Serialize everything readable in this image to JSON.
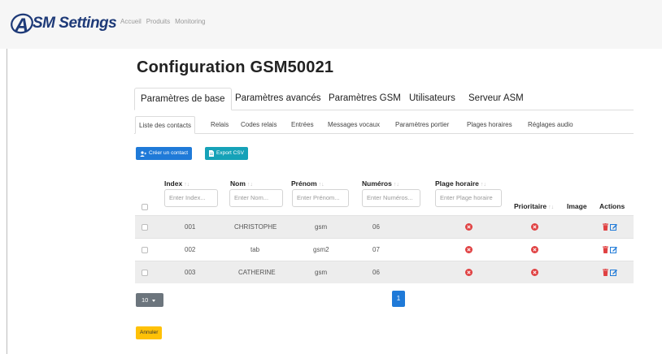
{
  "navbar": {
    "brand": "SM Settings",
    "links": [
      "Accueil",
      "Produits",
      "Monitoring"
    ]
  },
  "page": {
    "title": "Configuration GSM50021"
  },
  "main_tabs": [
    "Paramètres de base",
    "Paramètres avancés",
    "Paramètres GSM",
    "Utilisateurs",
    "Serveur ASM"
  ],
  "sub_tabs": [
    "Liste des contacts",
    "Relais",
    "Codes relais",
    "Entrées",
    "Messages vocaux",
    "Paramètres portier",
    "Plages horaires",
    "Réglages audio"
  ],
  "toolbar": {
    "create_label": "Créer un contact",
    "export_label": "Export CSV"
  },
  "table": {
    "headers": {
      "index": "Index",
      "nom": "Nom",
      "prenom": "Prénom",
      "numeros": "Numéros",
      "plage": "Plage horaire",
      "prioritaire": "Prioritaire",
      "image": "Image",
      "actions": "Actions"
    },
    "filters": {
      "index": "Enter Index...",
      "nom": "Enter Nom...",
      "prenom": "Enter Prénom...",
      "numeros": "Enter Numéros...",
      "plage": "Enter Plage horaire"
    },
    "rows": [
      {
        "index": "001",
        "nom": "CHRISTOPHE",
        "prenom": "gsm",
        "numeros": "06"
      },
      {
        "index": "002",
        "nom": "tab",
        "prenom": "gsm2",
        "numeros": "07"
      },
      {
        "index": "003",
        "nom": "CATHERINE",
        "prenom": "gsm",
        "numeros": "06"
      }
    ]
  },
  "pagination": {
    "page_size": "10",
    "current_page": "1"
  },
  "footer": {
    "cancel_label": "Annuler"
  },
  "colors": {
    "primary": "#1f7ad8",
    "info": "#16a2b8",
    "warning": "#ffc107",
    "danger": "#e04142",
    "secondary": "#6c757d",
    "brand": "#1e3a78"
  }
}
